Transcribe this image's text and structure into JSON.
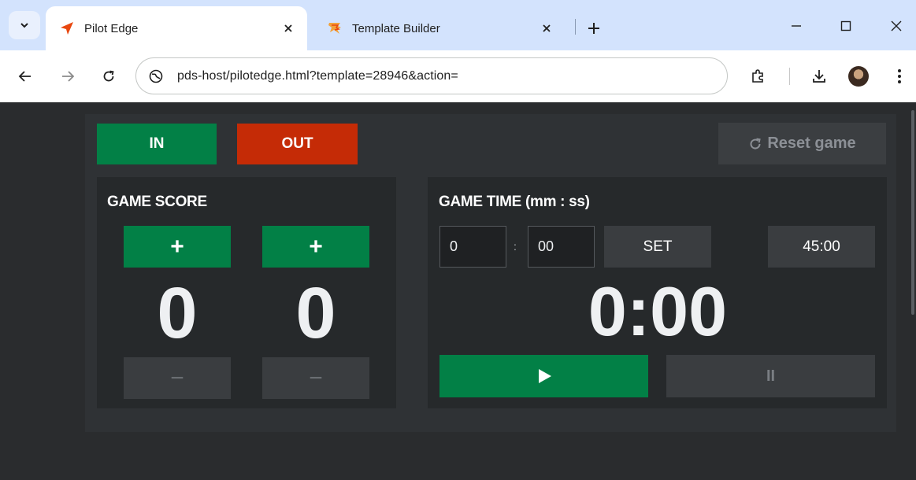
{
  "browser": {
    "tabs": [
      {
        "title": "Pilot Edge",
        "active": true,
        "icon": "paper-plane-icon"
      },
      {
        "title": "Template Builder",
        "active": false,
        "icon": "template-builder-icon"
      }
    ],
    "url": "pds-host/pilotedge.html?template=28946&action="
  },
  "controls": {
    "in_label": "IN",
    "out_label": "OUT",
    "reset_label": "Reset game"
  },
  "score": {
    "title": "GAME SCORE",
    "plus_label": "+",
    "minus_label": "−",
    "home": "0",
    "away": "0"
  },
  "time": {
    "title": "GAME TIME (mm : ss)",
    "minutes_value": "0",
    "separator": ":",
    "seconds_value": "00",
    "set_label": "SET",
    "preset_label": "45:00",
    "clock": "0:00",
    "pause_label": "II"
  },
  "colors": {
    "green": "#028046",
    "red": "#c52b06",
    "background": "#2a2c2e"
  }
}
